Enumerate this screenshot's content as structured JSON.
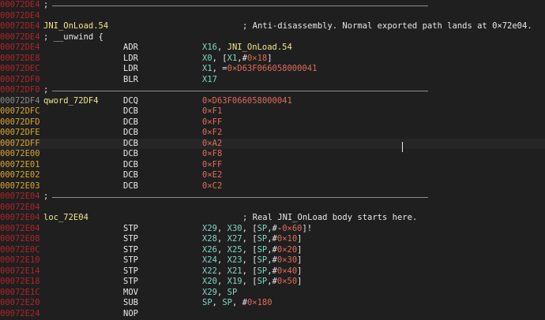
{
  "colors": {
    "background": "#1f1f1f",
    "address_red": "#b0242a",
    "address_gold": "#d9a62e",
    "address_grey": "#8a8a8a",
    "label": "#f0e68c",
    "register": "#7fd7c4",
    "number": "#e06c5a",
    "text": "#e8e8e8"
  },
  "lines": [
    {
      "addr": "00072DE4",
      "addr_color": "red",
      "kind": "sep",
      "semi": ";"
    },
    {
      "addr": "00072DE4",
      "addr_color": "red",
      "kind": "blank"
    },
    {
      "addr": "00072DE4",
      "addr_color": "red",
      "kind": "comment",
      "label": "JNI_OnLoad.54",
      "comment": "; Anti-disassembly. Normal exported path lands at 0×72e04."
    },
    {
      "addr": "00072DE4",
      "addr_color": "red",
      "kind": "text",
      "text": "; __unwind {"
    },
    {
      "addr": "00072DE4",
      "addr_color": "red",
      "kind": "insn",
      "mnem": "ADR",
      "ops": [
        {
          "t": "X16",
          "c": "reg"
        },
        {
          "t": ", ",
          "c": "pl"
        },
        {
          "t": "JNI_OnLoad.54",
          "c": "sym"
        }
      ]
    },
    {
      "addr": "00072DE8",
      "addr_color": "red",
      "kind": "insn",
      "mnem": "LDR",
      "ops": [
        {
          "t": "X0",
          "c": "reg"
        },
        {
          "t": ", [",
          "c": "pl"
        },
        {
          "t": "X1",
          "c": "reg"
        },
        {
          "t": ",#",
          "c": "pl"
        },
        {
          "t": "0×18",
          "c": "num"
        },
        {
          "t": "]",
          "c": "pl"
        }
      ]
    },
    {
      "addr": "00072DEC",
      "addr_color": "red",
      "kind": "insn",
      "mnem": "LDR",
      "ops": [
        {
          "t": "X1",
          "c": "reg"
        },
        {
          "t": ", =",
          "c": "pl"
        },
        {
          "t": "0×D63F066058000041",
          "c": "num"
        }
      ]
    },
    {
      "addr": "00072DF0",
      "addr_color": "red",
      "kind": "insn",
      "mnem": "BLR",
      "ops": [
        {
          "t": "X17",
          "c": "reg"
        }
      ]
    },
    {
      "addr": "00072DF0",
      "addr_color": "red",
      "kind": "sep",
      "semi": ";"
    },
    {
      "addr": "00072DF4",
      "addr_color": "grey",
      "kind": "insn",
      "label": "qword_72DF4",
      "mnem": "DCQ",
      "ops": [
        {
          "t": "0×D63F066058000041",
          "c": "num"
        }
      ]
    },
    {
      "addr": "00072DFC",
      "addr_color": "gold",
      "kind": "insn",
      "mnem": "DCB",
      "ops": [
        {
          "t": "0×F1",
          "c": "num"
        }
      ]
    },
    {
      "addr": "00072DFD",
      "addr_color": "gold",
      "kind": "insn",
      "mnem": "DCB",
      "ops": [
        {
          "t": "0×FF",
          "c": "num"
        }
      ]
    },
    {
      "addr": "00072DFE",
      "addr_color": "gold",
      "kind": "insn",
      "mnem": "DCB",
      "ops": [
        {
          "t": "0×F2",
          "c": "num"
        }
      ]
    },
    {
      "addr": "00072DFF",
      "addr_color": "gold",
      "kind": "insn",
      "mnem": "DCB",
      "ops": [
        {
          "t": "0×A2",
          "c": "num"
        }
      ],
      "highlight": true
    },
    {
      "addr": "00072E00",
      "addr_color": "gold",
      "kind": "insn",
      "mnem": "DCB",
      "ops": [
        {
          "t": "0×F8",
          "c": "num"
        }
      ]
    },
    {
      "addr": "00072E01",
      "addr_color": "gold",
      "kind": "insn",
      "mnem": "DCB",
      "ops": [
        {
          "t": "0×FF",
          "c": "num"
        }
      ]
    },
    {
      "addr": "00072E02",
      "addr_color": "gold",
      "kind": "insn",
      "mnem": "DCB",
      "ops": [
        {
          "t": "0×E2",
          "c": "num"
        }
      ]
    },
    {
      "addr": "00072E03",
      "addr_color": "gold",
      "kind": "insn",
      "mnem": "DCB",
      "ops": [
        {
          "t": "0×C2",
          "c": "num"
        }
      ]
    },
    {
      "addr": "00072E04",
      "addr_color": "red",
      "kind": "sep",
      "semi": ";"
    },
    {
      "addr": "00072E04",
      "addr_color": "red",
      "kind": "blank"
    },
    {
      "addr": "00072E04",
      "addr_color": "red",
      "kind": "comment",
      "label": "loc_72E04",
      "comment": "; Real JNI_OnLoad body starts here."
    },
    {
      "addr": "00072E04",
      "addr_color": "red",
      "kind": "insn",
      "mnem": "STP",
      "ops": [
        {
          "t": "X29",
          "c": "reg"
        },
        {
          "t": ", ",
          "c": "pl"
        },
        {
          "t": "X30",
          "c": "reg"
        },
        {
          "t": ", [",
          "c": "pl"
        },
        {
          "t": "SP",
          "c": "reg"
        },
        {
          "t": ",#-",
          "c": "pl"
        },
        {
          "t": "0×60",
          "c": "num"
        },
        {
          "t": "]!",
          "c": "pl"
        }
      ]
    },
    {
      "addr": "00072E08",
      "addr_color": "red",
      "kind": "insn",
      "mnem": "STP",
      "ops": [
        {
          "t": "X28",
          "c": "reg"
        },
        {
          "t": ", ",
          "c": "pl"
        },
        {
          "t": "X27",
          "c": "reg"
        },
        {
          "t": ", [",
          "c": "pl"
        },
        {
          "t": "SP",
          "c": "reg"
        },
        {
          "t": ",#",
          "c": "pl"
        },
        {
          "t": "0×10",
          "c": "num"
        },
        {
          "t": "]",
          "c": "pl"
        }
      ]
    },
    {
      "addr": "00072E0C",
      "addr_color": "red",
      "kind": "insn",
      "mnem": "STP",
      "ops": [
        {
          "t": "X26",
          "c": "reg"
        },
        {
          "t": ", ",
          "c": "pl"
        },
        {
          "t": "X25",
          "c": "reg"
        },
        {
          "t": ", [",
          "c": "pl"
        },
        {
          "t": "SP",
          "c": "reg"
        },
        {
          "t": ",#",
          "c": "pl"
        },
        {
          "t": "0×20",
          "c": "num"
        },
        {
          "t": "]",
          "c": "pl"
        }
      ]
    },
    {
      "addr": "00072E10",
      "addr_color": "red",
      "kind": "insn",
      "mnem": "STP",
      "ops": [
        {
          "t": "X24",
          "c": "reg"
        },
        {
          "t": ", ",
          "c": "pl"
        },
        {
          "t": "X23",
          "c": "reg"
        },
        {
          "t": ", [",
          "c": "pl"
        },
        {
          "t": "SP",
          "c": "reg"
        },
        {
          "t": ",#",
          "c": "pl"
        },
        {
          "t": "0×30",
          "c": "num"
        },
        {
          "t": "]",
          "c": "pl"
        }
      ]
    },
    {
      "addr": "00072E14",
      "addr_color": "red",
      "kind": "insn",
      "mnem": "STP",
      "ops": [
        {
          "t": "X22",
          "c": "reg"
        },
        {
          "t": ", ",
          "c": "pl"
        },
        {
          "t": "X21",
          "c": "reg"
        },
        {
          "t": ", [",
          "c": "pl"
        },
        {
          "t": "SP",
          "c": "reg"
        },
        {
          "t": ",#",
          "c": "pl"
        },
        {
          "t": "0×40",
          "c": "num"
        },
        {
          "t": "]",
          "c": "pl"
        }
      ]
    },
    {
      "addr": "00072E18",
      "addr_color": "red",
      "kind": "insn",
      "mnem": "STP",
      "ops": [
        {
          "t": "X20",
          "c": "reg"
        },
        {
          "t": ", ",
          "c": "pl"
        },
        {
          "t": "X19",
          "c": "reg"
        },
        {
          "t": ", [",
          "c": "pl"
        },
        {
          "t": "SP",
          "c": "reg"
        },
        {
          "t": ",#",
          "c": "pl"
        },
        {
          "t": "0×50",
          "c": "num"
        },
        {
          "t": "]",
          "c": "pl"
        }
      ]
    },
    {
      "addr": "00072E1C",
      "addr_color": "red",
      "kind": "insn",
      "mnem": "MOV",
      "ops": [
        {
          "t": "X29",
          "c": "reg"
        },
        {
          "t": ", ",
          "c": "pl"
        },
        {
          "t": "SP",
          "c": "reg"
        }
      ]
    },
    {
      "addr": "00072E20",
      "addr_color": "red",
      "kind": "insn",
      "mnem": "SUB",
      "ops": [
        {
          "t": "SP",
          "c": "reg"
        },
        {
          "t": ", ",
          "c": "pl"
        },
        {
          "t": "SP",
          "c": "reg"
        },
        {
          "t": ", #",
          "c": "pl"
        },
        {
          "t": "0×180",
          "c": "num"
        }
      ]
    },
    {
      "addr": "00072E24",
      "addr_color": "red",
      "kind": "insn",
      "mnem": "NOP",
      "ops": []
    }
  ]
}
